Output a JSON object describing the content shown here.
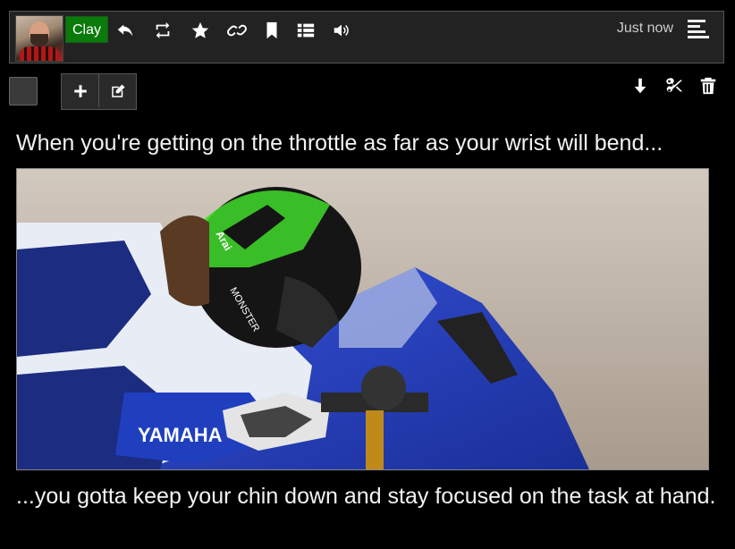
{
  "header": {
    "username": "Clay",
    "timestamp": "Just now",
    "icons": [
      "reply-icon",
      "retweet-icon",
      "star-icon",
      "link-icon",
      "bookmark-icon",
      "list-icon",
      "volume-icon",
      "menu-icon"
    ]
  },
  "toolbar": {
    "icons": [
      "plus-icon",
      "edit-icon",
      "arrow-down-icon",
      "scissors-icon",
      "trash-icon"
    ]
  },
  "post": {
    "caption_top": "When you're getting on the throttle as far as your wrist will bend...",
    "caption_bottom": "...you gotta keep your chin down and stay focused on the task at hand.",
    "image": {
      "brand_text": "YAMAHA",
      "helmet_text": "MONSTER",
      "helmet_brand": "Arai"
    }
  },
  "colors": {
    "badge": "#0a7a0a",
    "header_bg": "#222222",
    "bike_blue": "#1f3fbf",
    "helmet_green": "#3fdc2a"
  }
}
